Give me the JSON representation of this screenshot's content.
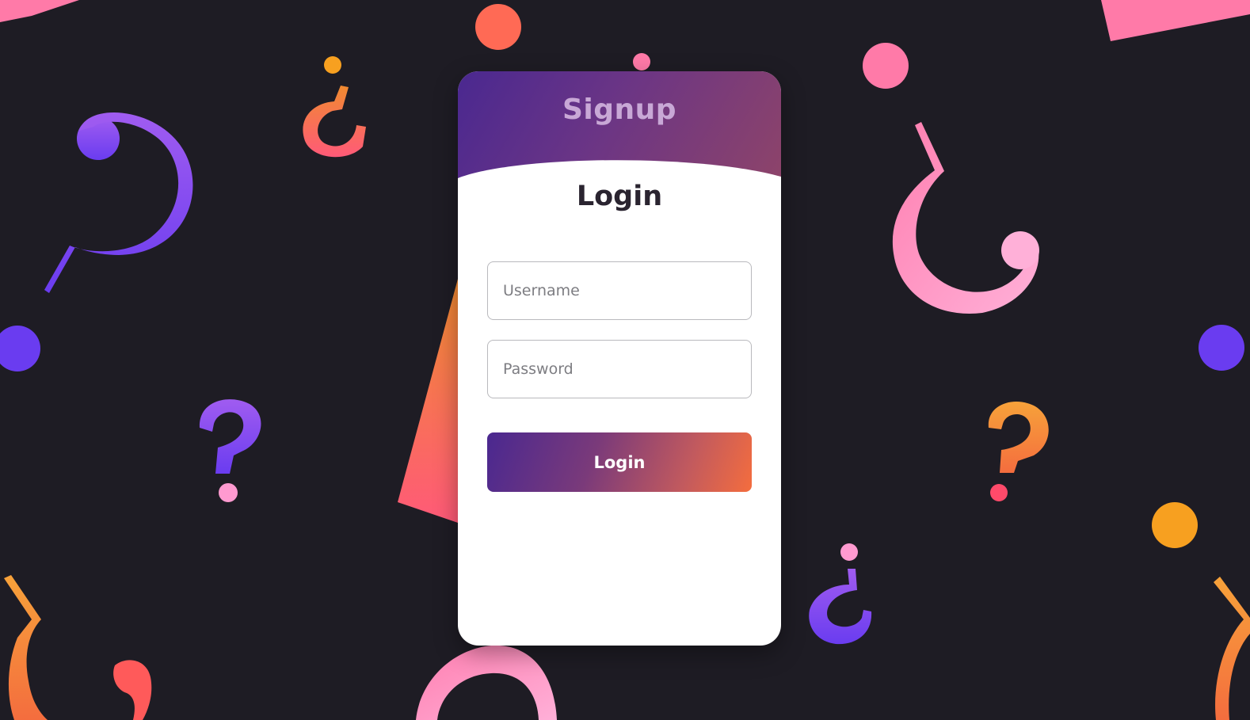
{
  "signup_tab": {
    "label": "Signup"
  },
  "login_form": {
    "title": "Login",
    "username_placeholder": "Username",
    "password_placeholder": "Password",
    "submit_label": "Login"
  },
  "colors": {
    "background": "#1e1c24",
    "card": "#ffffff",
    "accent_purple": "#4a2890",
    "accent_orange": "#f46d3e",
    "accent_pink": "#ff7aa8"
  }
}
